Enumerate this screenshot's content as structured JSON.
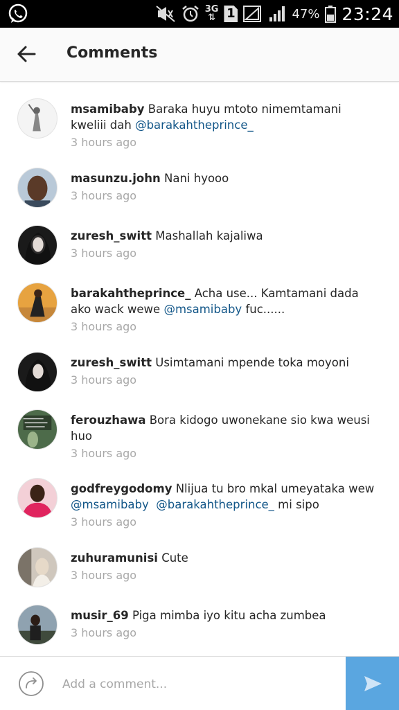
{
  "status_bar": {
    "network_type": "3G",
    "sim_slot": "1",
    "battery_percent": "47%",
    "time": "23:24"
  },
  "header": {
    "title": "Comments"
  },
  "comments": [
    {
      "username": "msamibaby",
      "text_before": "Baraka huyu mtoto nimemtamani kweliii dah ",
      "mention": "@barakahtheprince_",
      "text_after": "",
      "time": "3 hours ago"
    },
    {
      "username": "masunzu.john",
      "text_before": "Nani hyooo",
      "mention": "",
      "text_after": "",
      "time": "3 hours ago"
    },
    {
      "username": "zuresh_switt",
      "text_before": "Mashallah kajaliwa",
      "mention": "",
      "text_after": "",
      "time": "3 hours ago"
    },
    {
      "username": "barakahtheprince_",
      "text_before": "Acha use... Kamtamani dada ako wack wewe ",
      "mention": "@msamibaby",
      "text_after": " fuc......",
      "time": "3 hours ago"
    },
    {
      "username": "zuresh_switt",
      "text_before": "Usimtamani mpende toka moyoni",
      "mention": "",
      "text_after": "",
      "time": "3 hours ago"
    },
    {
      "username": "ferouzhawa",
      "text_before": "Bora kidogo uwonekane sio kwa weusi huo",
      "mention": "",
      "text_after": "",
      "time": "3 hours ago"
    },
    {
      "username": "godfreygodomy",
      "text_before": "Nlijua  tu bro mkal umeyataka wew ",
      "mention": "@msamibaby",
      "mention2": "@barakahtheprince_",
      "text_after": "  mi sipo",
      "time": "3 hours ago"
    },
    {
      "username": "zuhuramunisi",
      "text_before": "Cute",
      "mention": "",
      "text_after": "",
      "time": "3 hours ago"
    },
    {
      "username": "musir_69",
      "text_before": "Piga mimba iyo kitu acha zumbea",
      "mention": "",
      "text_after": "",
      "time": "3 hours ago"
    }
  ],
  "composer": {
    "placeholder": "Add a comment..."
  },
  "icons": {
    "notification": "whatsapp-icon",
    "back": "arrow-left-icon",
    "composer_left": "reply-arrow-icon",
    "send": "send-icon"
  },
  "colors": {
    "mention": "#125688",
    "send_button": "#5aa6e0",
    "timestamp": "#a8a8a8"
  }
}
